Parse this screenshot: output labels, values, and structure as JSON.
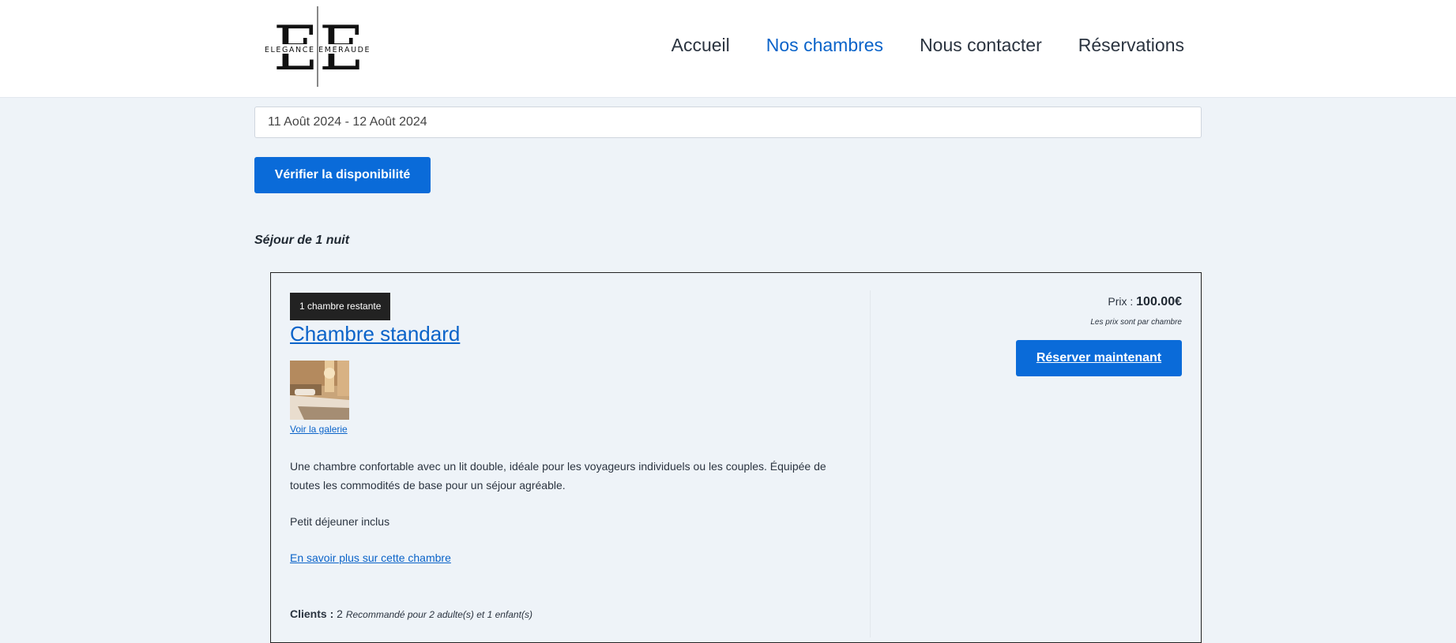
{
  "brand": {
    "name": "ELEGANCE EMERAUDE",
    "monogram": "EE"
  },
  "nav": {
    "items": [
      {
        "label": "Accueil"
      },
      {
        "label": "Nos chambres",
        "active": true
      },
      {
        "label": "Nous contacter"
      },
      {
        "label": "Réservations"
      }
    ]
  },
  "search": {
    "date_range": "11 Août 2024 - 12 Août 2024",
    "check_button": "Vérifier la disponibilité",
    "stay_summary": "Séjour de 1 nuit"
  },
  "room": {
    "badge": "1 chambre restante",
    "title": "Chambre standard",
    "gallery_link": "Voir la galerie",
    "description": "Une chambre confortable avec un lit double, idéale pour les voyageurs individuels ou les couples. Équipée de toutes les commodités de base pour un séjour agréable.",
    "breakfast": "Petit déjeuner inclus",
    "more_link": "En savoir plus sur cette chambre",
    "clients_label": "Clients :",
    "clients_count": "2",
    "clients_recommendation": "Recommandé pour 2 adulte(s) et 1 enfant(s)",
    "price_label": "Prix :",
    "price_value": "100.00€",
    "price_note": "Les prix sont par chambre",
    "book_button": "Réserver maintenant"
  },
  "colors": {
    "accent": "#0a6bd9",
    "link": "#0a63c9",
    "page_bg": "#eef3f8",
    "badge_bg": "#222222"
  }
}
